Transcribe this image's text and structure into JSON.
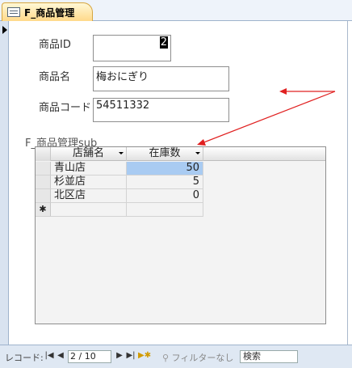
{
  "tab": {
    "title": "F_商品管理",
    "icon": "form-icon"
  },
  "form": {
    "fields": [
      {
        "label": "商品ID",
        "value": "2"
      },
      {
        "label": "商品名",
        "value": "梅おにぎり"
      },
      {
        "label": "商品コード",
        "value": "54511332"
      }
    ]
  },
  "subform": {
    "label": "F_商品管理sub",
    "columns": [
      "店舗名",
      "在庫数"
    ],
    "rows": [
      {
        "store": "青山店",
        "qty": "50"
      },
      {
        "store": "杉並店",
        "qty": "5"
      },
      {
        "store": "北区店",
        "qty": "0"
      }
    ],
    "new_row_marker": "✱"
  },
  "navbar": {
    "record_label": "レコード:",
    "position": "2 / 10",
    "filter_label": "フィルターなし",
    "search_label": "検索"
  },
  "colors": {
    "annotation_arrow": "#e02020",
    "selected_cell": "#a9cbf2"
  }
}
